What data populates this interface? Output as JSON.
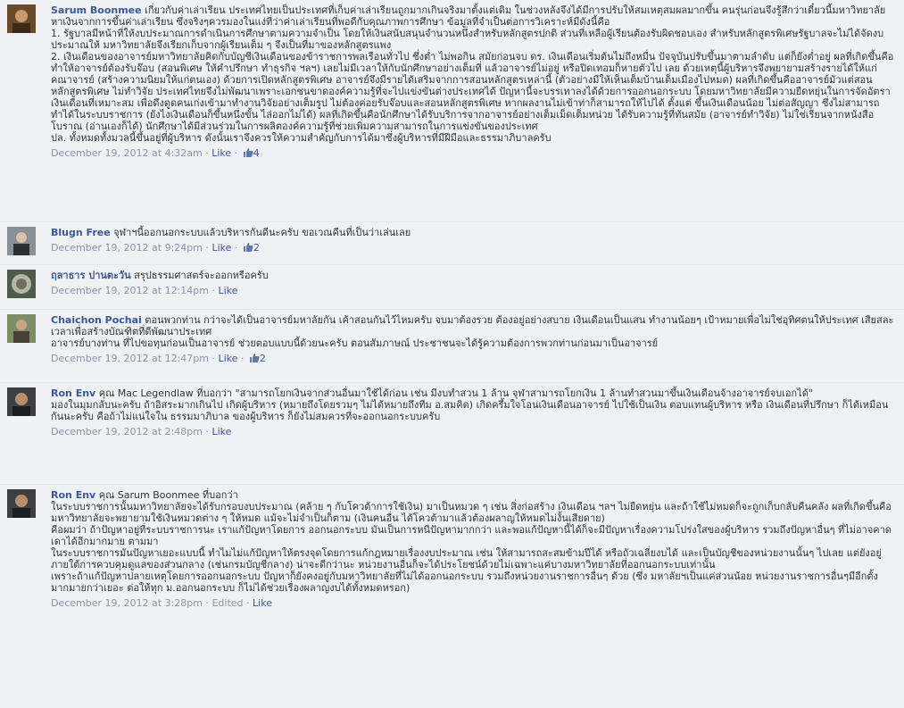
{
  "comments": [
    {
      "author": "Sarum Boonmee",
      "paragraphs": [
        "เกี่ยวกับค่าเล่าเรียน ประเทศไทยเป็นประเทศที่เก็บค่าเล่าเรียนถูกมากเกินจริงมาตั้งแต่เดิม ในช่วงหลังจึงได้มีการปรับให้สมเหตุสมผลมากขึ้น คนรุ่นก่อนจึงรู้สึกว่าเดี๋ยวนี้มหาวิทยาลัยหาเงินจากการขึ้นค่าเล่าเรียน ซึ่งจริงๆควรมองในแง่ที่ว่าค่าเล่าเรียนที่พอดีกับคุณภาพการศึกษา ข้อมูลที่จำเป็นต่อการวิเคราะห์มีดังนี้คือ",
        "1. รัฐบาลมีหน้าที่ให้งบประมาณการดำเนินการศึกษาตามความจำเป็น โดยให้เงินสนับสนุนจำนวนหนึ่งสำหรับหลักสูตรปกติ ส่วนที่เหลือผู้เรียนต้องรับผิดชอบเอง สำหรับหลักสูตรพิเศษรัฐบาลจะไม่ได้จัดงบประมาณให้ มหาวิทยาลัยจึงเรียกเก็บจากผู้เรียนเต็ม ๆ จึงเป็นที่มาของหลักสูตรแพง",
        "2. เงินเดือนของอาจารย์มหาวิทยาลัยคิดกับบัญชีเงินเดือนของข้าราชการพลเรือนทั่วไป ซึ่งต่ำ ไม่พอกิน สมัยก่อนจบ ดร. เงินเดือนเริ่มต้นไม่ถึงหมื่น ปัจจุบันปรับขึ้นมาตามลำดับ แต่ก็ยังต่ำอยู่ ผลที่เกิดขึ้นคือทำให้อาจารย์ต้องรับจ๊อบ (สอนพิเศษ ให้คำปรึกษา ทำธุรกิจ ฯลฯ) เลยไม่มีเวลาให้กับนักศึกษาอย่างเต็มที่ แล้วอาจารย์ไม่อยู่ หรือปิดเทอมก็หายตัวไป เลย ด้วยเหตุนี้ผู้บริหารจึงพยายามสร้างรายได้ให้แก่คณาจารย์ (สร้างความนิยมให้แก่ตนเอง) ด้วยการเปิดหลักสูตรพิเศษ อาจารย์จึงมีรายได้เสริมจากการสอนหลักสูตรเหล่านี้ (ตัวอย่างมีให้เห็นเต็มบ้านเต็มเมืองไปหมด) ผลที่เกิดขึ้นคืออาจารย์มัวแต่สอนหลักสูตรพิเศษ ไม่ทำวิจัย ประเทศไทยจึงไม่พัฒนาเพราะเอกชนขาดองค์ความรู้ที่จะไปแข่งขันต่างประเทศได้ ปัญหานี้จะบรรเทาลงได้ด้วยการออกนอกระบบ โดยมหาวิทยาลัยมีความยืดหยุ่นในการจัดอัตราเงินเดือนที่เหมาะสม เพื่อดึงดูดคนเก่งเข้ามาทำงานวิจัยอย่างเต็มรูป ไม่ต้องค่อยรับจ๊อบและสอนหลักสูตรพิเศษ หากผลงานไม่เข้าท่าก็สามารถให้ไปได้ ตั้งแต่ ขึ้นเงินเดือนน้อย ไม่ต่อสัญญา ซึ่งไม่สามารถทำได้ในระบบราชการ (ยังไงเงินเดือนก็ขึ้นหนึ่งขั้น ไล่ออกไม่ได้) ผลที่เกิดขึ้นคือนักศึกษาได้รับบริการจากอาจารย์อย่างเต็มเม็ดเต็มหน่วย ได้รับความรู้ที่ทันสมัย (อาจารย์ทำวิจัย) ไม่ใช่เรียนจากหนังสือโบราณ (อ่านเองก็ได้) นักศึกษาได้มีส่วนร่วมในการผลิตองค์ความรู้ที่ช่วยเพิ่มความสามารถในการแข่งขันของประเทศ",
        "ปล. ทั้งหมดทั้งมวลนี้ขึ้นอยู่ที่ผู้บริหาร ดังนั้นเราจึงควรให้ความสำคัญกับการได้มาซึ่งผู้บริหารที่มีฝีมือและธรรมาภิบาลครับ"
      ],
      "date": "December 19, 2012 at 4:32am",
      "like_label": "Like",
      "likes": "4"
    },
    {
      "author": "Blugn Free",
      "paragraphs": [
        "จุฬาฯนี้ออกนอกระบบแล้วบริหารกันดีนะครับ ขอเวณคืนที่เป็นว่าเล่นเลย"
      ],
      "date": "December 19, 2012 at 9:24pm",
      "like_label": "Like",
      "likes": "2"
    },
    {
      "author": "ฤลาธาร ปานตะวัน",
      "paragraphs": [
        "สรุปธรรมศาสตร์จะออกหรือครับ"
      ],
      "date": "December 19, 2012 at 12:14pm",
      "like_label": "Like",
      "likes": ""
    },
    {
      "author": "Chaichon Pochai",
      "paragraphs": [
        "ตอนพวกท่าน กว่าจะได้เป็นอาจารย์มหาลัยกัน เค้าสอนกันไว้ไหมครับ จบมาต้องรวย ต้องอยู่อย่างสบาย เงินเดือนเป็นแสน ทำงานน้อยๆ เป้าหมายเพื่อไม่ใช่อุทิศตนให้ประเทศ เสียสละเวลาเพื่อสร้างบัณฑิตที่ดีพัฒนาประเทศ",
        "อาจารย์บางท่าน ที่ไปขอทุนก่อนเป็นอาจารย์ ช่วยตอบแบบนี้ด้วยนะครับ ตอนสัมภาษณ์ ประชาชนจะได้รู้ความต้องการพวกท่านก่อนมาเป็นอาจารย์"
      ],
      "date": "December 19, 2012 at 12:47pm",
      "like_label": "Like",
      "likes": "2"
    },
    {
      "author": "Ron Env",
      "paragraphs": [
        "คุณ Mac Legendlaw ที่บอกว่า \"สามารถโยกเงินจากส่วนอื่นมาใช้ได้ก่อน เช่น มีงบทำสวน 1 ล้าน จุฬาสามารถโยกเงิน 1 ล้านทำสวนมาขึ้นเงินเดือนจ้างอาจารย์จบเอกได้\"",
        "",
        "มองในมุมกลับนะครับ ถ้าอิสระมากเกินไป เกิดผู้บริหาร (หมายถึงโดยรวมๆ ไม่ได้หมายถึงทีม อ.สมคิด) เกิดครึ้มใจโอนเงินเดือนอาจารย์ ไปใช้เป็นเงิน ตอบแทนผู้บริหาร หรือ เงินเดือนที่ปรึกษา ก็ได้เหมือนกันนะครับ คือถ้าไม่แน่ใจใน ธรรมมาภิบาล ของผู้บริหาร ก็ยังไม่สมควรที่จะออกนอกระบบครับ"
      ],
      "date": "December 19, 2012 at 2:48pm",
      "like_label": "Like",
      "likes": ""
    },
    {
      "author": "Ron Env",
      "paragraphs": [
        "คุณ Sarum Boonmee ที่บอกว่า",
        "",
        "ในระบบราชการนั้นมหาวิทยาลัยจะได้รับกรอบงบประมาณ (คล้าย ๆ กับโควต้าการใช้เงิน) มาเป็นหมวด ๆ เช่น สิ่งก่อสร้าง เงินเดือน ฯลฯ ไม่ยืดหยุ่น และถ้าใช้ไม่หมดก็จะถูกเก็บกลับคืนคลัง ผลที่เกิดขึ้นคือมหาวิทยาลัยจะพยายามใช้เงินหมวดต่าง ๆ ให้หมด แม้จะไม่จำเป็นก็ตาม (เงินคนอื่น ได้โควต้ามาแล้วต้องผลาญให้หมดไม่งั้นเสียดาย)",
        "",
        "คือผมว่า ถ้าปัญหาอยู่ที่ระบบราชการนะ เราแก้ปัญหาโดยการ ออกนอกระบบ มันเป็นการหนีปัญหามากกว่า และพอแก้ปัญหานี้ได้ก็จะมีปัญหาเรื่องความโปร่งใสของผู้บริหาร รวมถึงปัญหาอื่นๆ ที่ไม่อาจคาดเดาได้อีกมากมาย ตามมา",
        "",
        "ในระบบราชการมันปัญหาเยอะแบบนี้ ทำไมไม่แก้ปัญหาให้ตรงจุดโดยการแก้กฎหมายเรื่องงบประมาณ เช่น ให้สามารถสะสมข้ามปีได้ หรือถัวเฉลี่ยงบได้ และเป็นบัญชีของหน่วยงานนั้นๆ ไปเลย แต่ยังอยู่ภายใต้การควบคุมดูแลของส่วนกลาง (เช่นกรมบัญชีกลาง) น่าจะดีกว่านะ หน่วยงานอื่นก็จะได้ประโยชน์ด้วยไม่เฉพาะแค่บางมหาวิทยาลัยที่ออกนอกระบบเท่านั้น",
        "",
        "เพราะถ้าแก้ปัญหาปลายเหตุโดยการออกนอกระบบ ปัญหาก็ยังคงอยู่กับมหาวิทยาลัยที่ไม่ได้ออกนอกระบบ รวมถึงหน่วยงานราชการอื่นๆ ด้วย (ซึ่ง มหาลัยฯเป็นแค่ส่วนน้อย หน่วยงานราชการอื่นๆมีอีกตั้งมากมายกว่าเยอะ ต่อให้ทุก ม.ออกนอกระบบ ก็ไม่ได้ช่วยเรื่องผลาญงบได้ทั้งหมดหรอก)"
      ],
      "date": "December 19, 2012 at 3:28pm",
      "edited_label": "Edited",
      "like_label": "Like",
      "likes": ""
    }
  ],
  "colors": {
    "link": "#3b5998",
    "meta": "#8a94a8",
    "background": "#eff1f5"
  },
  "icons": {
    "like_count": "thumbs-up-icon"
  }
}
